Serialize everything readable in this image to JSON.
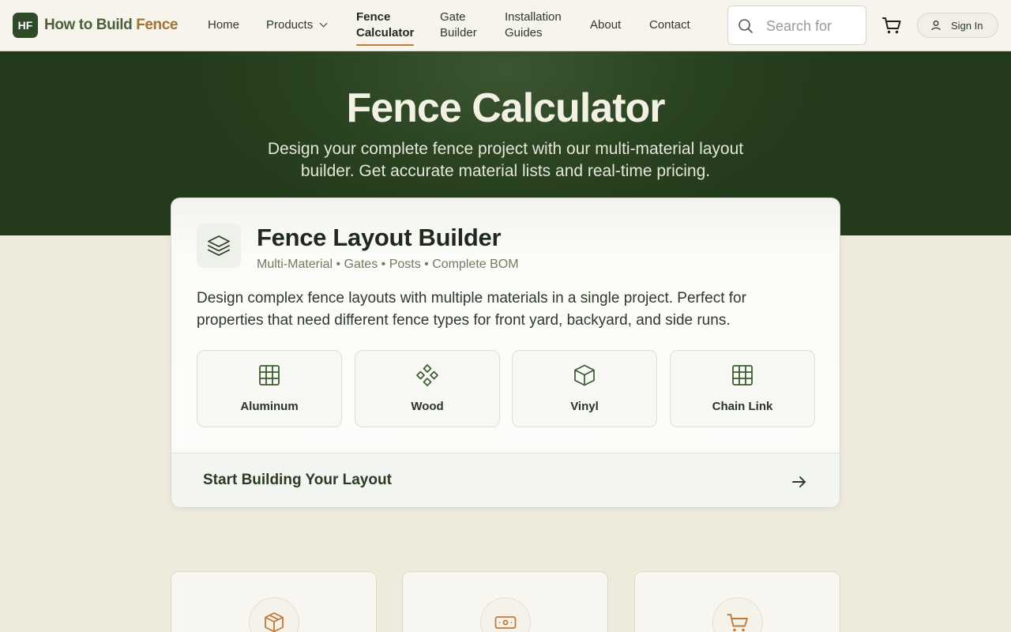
{
  "brand": {
    "mark": "HF",
    "name_part1": "How to Build",
    "name_part2": "Fence"
  },
  "nav": {
    "home": "Home",
    "products": "Products",
    "fence_calculator_l1": "Fence",
    "fence_calculator_l2": "Calculator",
    "gate_builder_l1": "Gate",
    "gate_builder_l2": "Builder",
    "installation_l1": "Installation",
    "installation_l2": "Guides",
    "about": "About",
    "contact": "Contact"
  },
  "search": {
    "placeholder": "Search for",
    "value": ""
  },
  "signin": {
    "label": "Sign In"
  },
  "hero": {
    "title": "Fence Calculator",
    "subtitle": "Design your complete fence project with our multi-material layout builder. Get accurate material lists and real-time pricing."
  },
  "builder": {
    "icon": "layers-icon",
    "title": "Fence Layout Builder",
    "subtitle": "Multi-Material • Gates • Posts • Complete BOM",
    "description": "Design complex fence layouts with multiple materials in a single project. Perfect for properties that need different fence types for front yard, backyard, and side runs.",
    "materials": [
      {
        "label": "Aluminum",
        "icon": "grid-icon"
      },
      {
        "label": "Wood",
        "icon": "diamonds-icon"
      },
      {
        "label": "Vinyl",
        "icon": "box-icon"
      },
      {
        "label": "Chain Link",
        "icon": "grid-icon"
      }
    ],
    "cta": "Start Building Your Layout"
  },
  "features": [
    {
      "icon": "package-icon"
    },
    {
      "icon": "money-icon"
    },
    {
      "icon": "cart-icon"
    }
  ],
  "colors": {
    "brand_green": "#2f4a26",
    "accent": "#c17a3a",
    "background": "#efebdc"
  }
}
